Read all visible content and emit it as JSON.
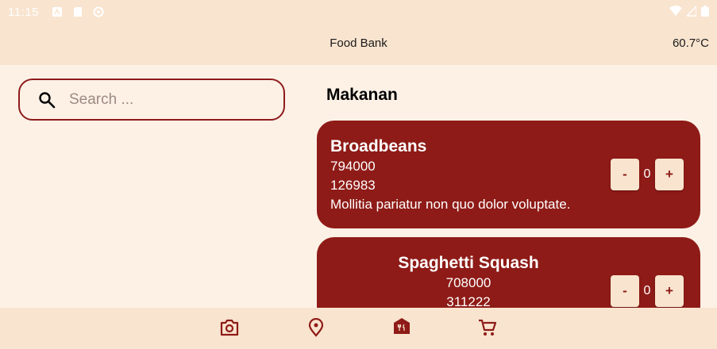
{
  "status_bar": {
    "time": "11:15"
  },
  "app_bar": {
    "title": "Food Bank",
    "temperature": "60.7°C"
  },
  "search": {
    "placeholder": "Search ..."
  },
  "section": {
    "title": "Makanan"
  },
  "items": [
    {
      "name": "Broadbeans",
      "line1": "794000",
      "line2": "126983",
      "description": "Mollitia pariatur non quo dolor voluptate.",
      "count": "0",
      "minus": "-",
      "plus": "+"
    },
    {
      "name": "Spaghetti Squash",
      "line1": "708000",
      "line2": "311222",
      "count": "0",
      "minus": "-",
      "plus": "+"
    }
  ],
  "colors": {
    "accent": "#8e1b17",
    "bar_bg": "#f9e4cf",
    "page_bg": "#fdf1e6"
  },
  "bottom_nav": [
    "camera-icon",
    "location-pin-icon",
    "restaurant-icon",
    "cart-icon"
  ]
}
